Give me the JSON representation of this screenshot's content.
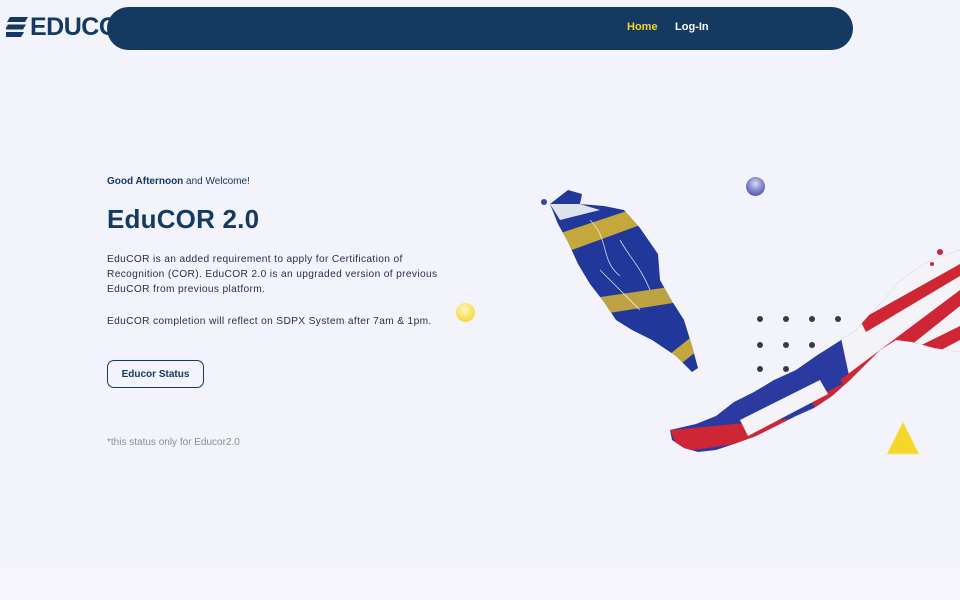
{
  "logo": {
    "text": "EDUCOR",
    "icon": "educor-logo-icon"
  },
  "nav": {
    "home_label": "Home",
    "login_label": "Log-In"
  },
  "hero": {
    "greeting_bold": "Good Afternoon",
    "greeting_rest": " and Welcome!",
    "title": "EduCOR 2.0",
    "description": "EduCOR is an added requirement to apply for Certification of Recognition (COR). EduCOR 2.0 is an upgraded version of previous EduCOR from previous platform.",
    "completion_note": "EduCOR completion will reflect on SDPX System after 7am & 1pm.",
    "status_button_label": "Educor Status",
    "footnote": "*this status only for Educor2.0"
  },
  "colors": {
    "navy": "#153a62",
    "accent_yellow": "#f2d51e",
    "background": "#f3f3fb"
  },
  "decor": {
    "map_image": "malaysia-flag-map",
    "triangle_icon": "yellow-triangle-icon"
  }
}
